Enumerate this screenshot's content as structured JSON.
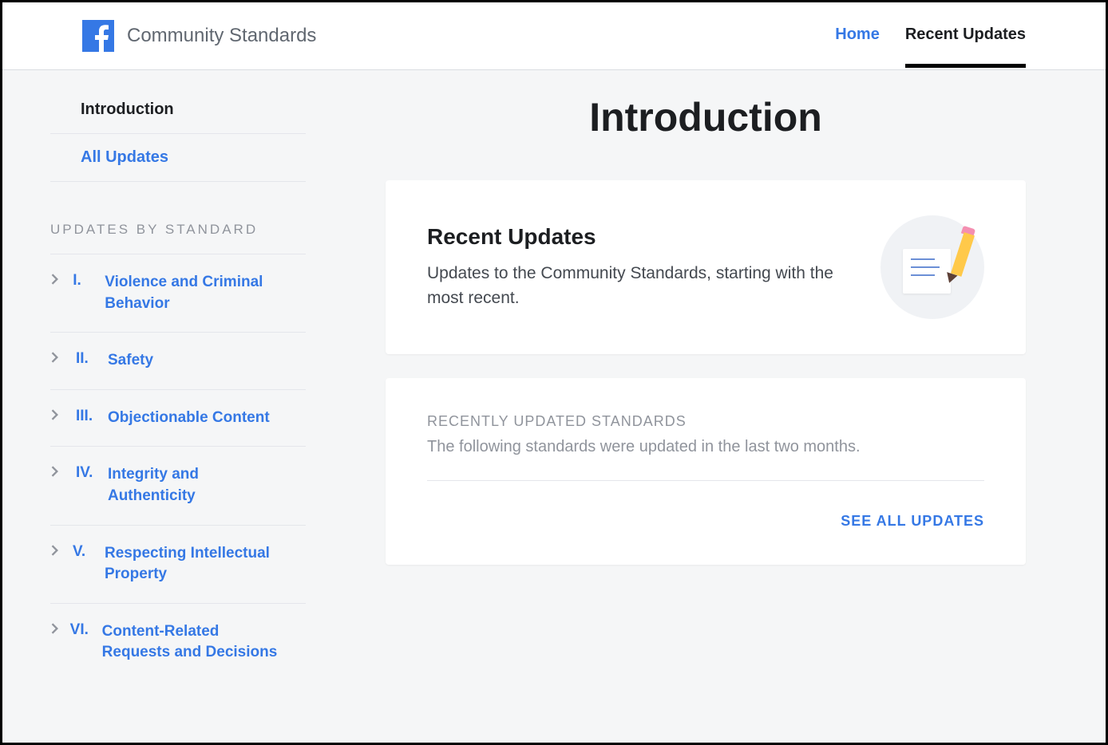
{
  "header": {
    "site_title": "Community Standards",
    "nav_home": "Home",
    "nav_recent": "Recent Updates"
  },
  "sidebar": {
    "introduction": "Introduction",
    "all_updates": "All Updates",
    "section_header": "UPDATES BY STANDARD",
    "standards": [
      {
        "roman": "I.",
        "label": "Violence and Criminal Behavior"
      },
      {
        "roman": "II.",
        "label": "Safety"
      },
      {
        "roman": "III.",
        "label": "Objectionable Content"
      },
      {
        "roman": "IV.",
        "label": "Integrity and Authenticity"
      },
      {
        "roman": "V.",
        "label": "Respecting Intellectual Property"
      },
      {
        "roman": "VI.",
        "label": "Content-Related Requests and Decisions"
      }
    ]
  },
  "main": {
    "page_title": "Introduction",
    "card1": {
      "title": "Recent Updates",
      "desc": "Updates to the Community Standards, starting with the most recent."
    },
    "card2": {
      "header": "RECENTLY UPDATED STANDARDS",
      "desc": "The following standards were updated in the last two months.",
      "see_all": "SEE ALL UPDATES"
    }
  }
}
